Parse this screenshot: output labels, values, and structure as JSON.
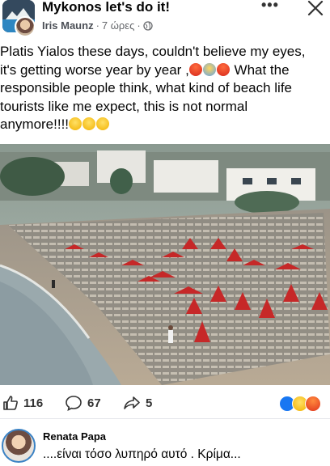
{
  "header": {
    "group_name": "Mykonos let's do it!",
    "author": "Iris Maunz",
    "separator": "·",
    "time": "7 ώρες",
    "dot": "·",
    "more_label": "•••"
  },
  "post": {
    "line1": "Platis Yialos these days, couldn't believe my eyes,",
    "line2a": "it's getting worse year by year ,",
    "line2b": " What the",
    "line3": "responsible people think, what kind of beach life",
    "line4": "tourists like me expect, this is not normal",
    "line5": "anymore!!!!"
  },
  "stats": {
    "likes": "116",
    "comments": "67",
    "shares": "5"
  },
  "comment": {
    "name": "Renata Papa",
    "text": "....είναι τόσο λυπηρό αυτό . Κρίμα..."
  },
  "colors": {
    "text": "#050505",
    "secondary": "#65676b",
    "like_blue": "#1877f2",
    "umbrella_red": "#c62828"
  },
  "icons": [
    "globe-icon",
    "more-icon",
    "close-icon",
    "like-icon",
    "comment-icon",
    "share-icon"
  ]
}
